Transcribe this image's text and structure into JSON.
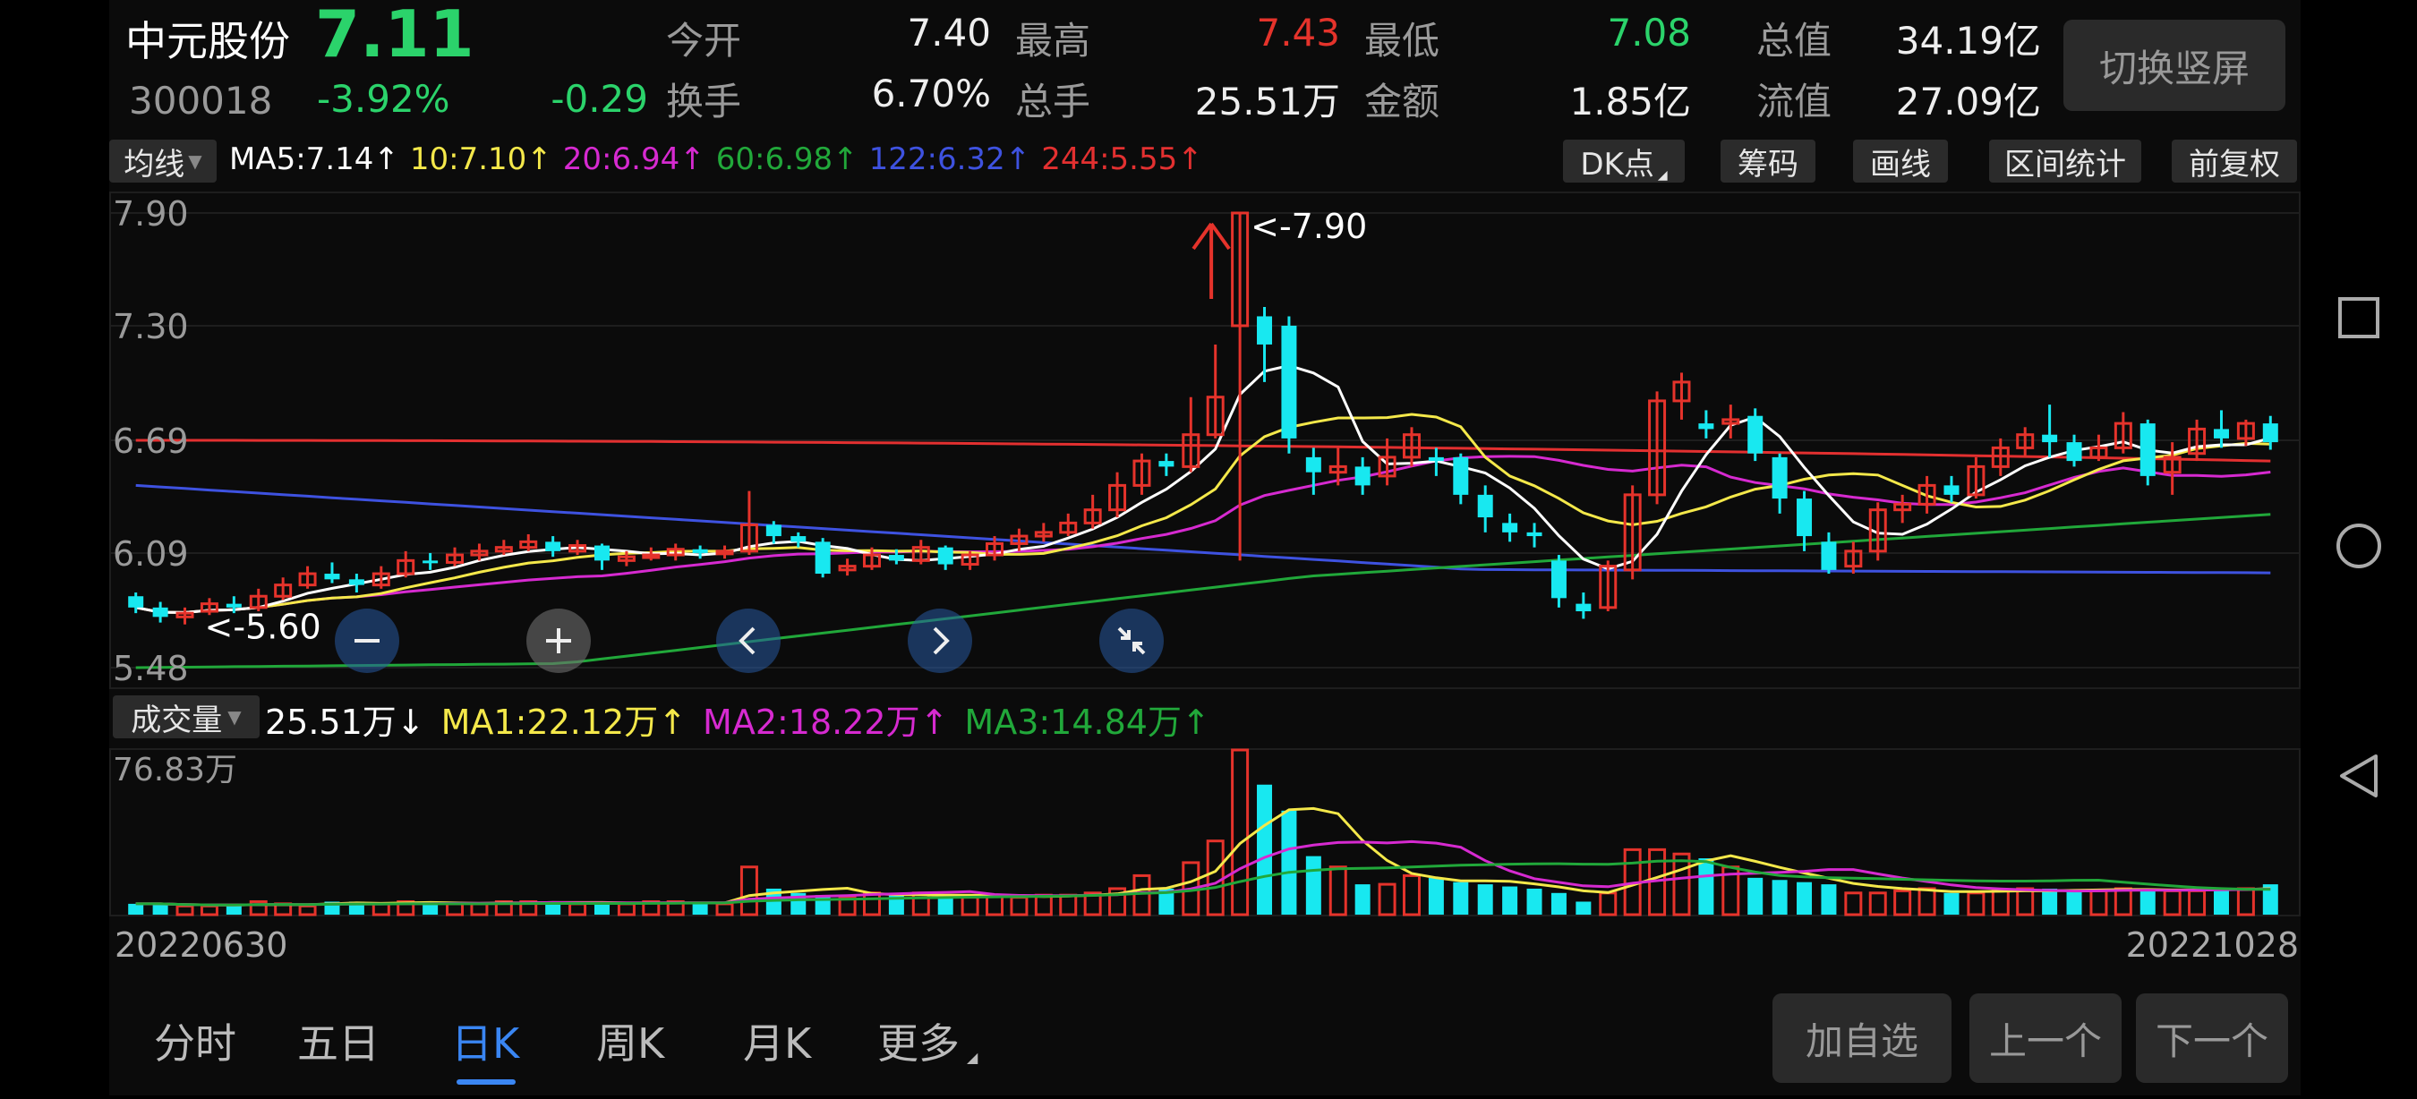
{
  "stock": {
    "name": "中元股份",
    "code": "300018",
    "price": "7.11",
    "change_pct": "-3.92%",
    "change": "-0.29"
  },
  "stats": [
    {
      "label": "今开",
      "value": "7.40",
      "color": "white"
    },
    {
      "label": "最高",
      "value": "7.43",
      "color": "red"
    },
    {
      "label": "最低",
      "value": "7.08",
      "color": "green"
    },
    {
      "label": "总值",
      "value": "34.19亿",
      "color": "white"
    },
    {
      "label": "换手",
      "value": "6.70%",
      "color": "white"
    },
    {
      "label": "总手",
      "value": "25.51万",
      "color": "white"
    },
    {
      "label": "金额",
      "value": "1.85亿",
      "color": "white"
    },
    {
      "label": "流值",
      "value": "27.09亿",
      "color": "white"
    }
  ],
  "switch_button": "切换竖屏",
  "ma_bar": {
    "selector": "均线",
    "items": [
      {
        "text": "MA5:7.14↑",
        "color": "#ffffff"
      },
      {
        "text": "10:7.10↑",
        "color": "#f4e84a"
      },
      {
        "text": "20:6.94↑",
        "color": "#d62ad0"
      },
      {
        "text": "60:6.98↑",
        "color": "#21a83a"
      },
      {
        "text": "122:6.32↑",
        "color": "#3e52e0"
      },
      {
        "text": "244:5.55↑",
        "color": "#e33030"
      }
    ],
    "tools": [
      "DK点",
      "筹码",
      "画线",
      "区间统计",
      "前复权"
    ]
  },
  "price_axis": [
    "7.90",
    "7.30",
    "6.69",
    "6.09",
    "5.48"
  ],
  "annotations": {
    "high": "<-7.90",
    "low": "<-5.60"
  },
  "controls": [
    "zoom-out",
    "zoom-in",
    "scroll-left",
    "scroll-right",
    "collapse"
  ],
  "volume_bar": {
    "selector": "成交量",
    "items": [
      {
        "text": "25.51万↓",
        "color": "#ffffff"
      },
      {
        "text": "MA1:22.12万↑",
        "color": "#f4e84a"
      },
      {
        "text": "MA2:18.22万↑",
        "color": "#d62ad0"
      },
      {
        "text": "MA3:14.84万↑",
        "color": "#21a83a"
      }
    ],
    "axis_max": "76.83万"
  },
  "dates": {
    "start": "20220630",
    "end": "20221028"
  },
  "tabs": [
    {
      "label": "分时",
      "active": false
    },
    {
      "label": "五日",
      "active": false
    },
    {
      "label": "日K",
      "active": true
    },
    {
      "label": "周K",
      "active": false
    },
    {
      "label": "月K",
      "active": false
    },
    {
      "label": "更多",
      "active": false
    }
  ],
  "bottom_buttons": [
    "加自选",
    "上一个",
    "下一个"
  ],
  "colors": {
    "up": "#e5332b",
    "down": "#18e8f0",
    "ma5": "#ffffff",
    "ma10": "#f4e84a",
    "ma20": "#d62ad0",
    "ma60": "#21a83a",
    "ma122": "#3e52e0",
    "ma244": "#e33030"
  },
  "chart_data": {
    "type": "candlestick",
    "y_range": [
      5.48,
      7.9
    ],
    "candles": [
      [
        5.86,
        5.8,
        5.88,
        5.77
      ],
      [
        5.8,
        5.75,
        5.83,
        5.72
      ],
      [
        5.75,
        5.77,
        5.8,
        5.71
      ],
      [
        5.78,
        5.82,
        5.85,
        5.76
      ],
      [
        5.82,
        5.8,
        5.86,
        5.77
      ],
      [
        5.8,
        5.86,
        5.9,
        5.78
      ],
      [
        5.86,
        5.92,
        5.96,
        5.84
      ],
      [
        5.92,
        5.98,
        6.02,
        5.9
      ],
      [
        5.98,
        5.95,
        6.04,
        5.93
      ],
      [
        5.95,
        5.92,
        5.98,
        5.88
      ],
      [
        5.92,
        5.98,
        6.02,
        5.9
      ],
      [
        5.98,
        6.05,
        6.1,
        5.96
      ],
      [
        6.05,
        6.04,
        6.09,
        6.0
      ],
      [
        6.04,
        6.08,
        6.12,
        6.02
      ],
      [
        6.08,
        6.1,
        6.14,
        6.05
      ],
      [
        6.1,
        6.12,
        6.16,
        6.08
      ],
      [
        6.12,
        6.15,
        6.19,
        6.1
      ],
      [
        6.15,
        6.1,
        6.18,
        6.07
      ],
      [
        6.1,
        6.13,
        6.16,
        6.08
      ],
      [
        6.13,
        6.05,
        6.14,
        6.0
      ],
      [
        6.05,
        6.07,
        6.1,
        6.02
      ],
      [
        6.07,
        6.08,
        6.12,
        6.05
      ],
      [
        6.08,
        6.11,
        6.14,
        6.05
      ],
      [
        6.11,
        6.09,
        6.13,
        6.06
      ],
      [
        6.09,
        6.1,
        6.13,
        6.06
      ],
      [
        6.1,
        6.24,
        6.42,
        6.08
      ],
      [
        6.24,
        6.18,
        6.26,
        6.14
      ],
      [
        6.18,
        6.15,
        6.2,
        6.12
      ],
      [
        6.15,
        5.98,
        6.17,
        5.96
      ],
      [
        6.0,
        6.02,
        6.06,
        5.97
      ],
      [
        6.02,
        6.08,
        6.12,
        6.0
      ],
      [
        6.08,
        6.05,
        6.11,
        6.03
      ],
      [
        6.05,
        6.12,
        6.16,
        6.03
      ],
      [
        6.12,
        6.03,
        6.13,
        6.0
      ],
      [
        6.03,
        6.08,
        6.1,
        6.0
      ],
      [
        6.08,
        6.14,
        6.18,
        6.05
      ],
      [
        6.14,
        6.18,
        6.22,
        6.1
      ],
      [
        6.18,
        6.2,
        6.25,
        6.15
      ],
      [
        6.2,
        6.25,
        6.3,
        6.18
      ],
      [
        6.25,
        6.32,
        6.4,
        6.22
      ],
      [
        6.32,
        6.45,
        6.52,
        6.28
      ],
      [
        6.45,
        6.58,
        6.62,
        6.4
      ],
      [
        6.58,
        6.55,
        6.62,
        6.5
      ],
      [
        6.55,
        6.72,
        6.92,
        6.52
      ],
      [
        6.72,
        6.92,
        7.2,
        6.7
      ],
      [
        7.3,
        7.9,
        7.9,
        6.05
      ],
      [
        7.35,
        7.2,
        7.4,
        7.0
      ],
      [
        7.3,
        6.7,
        7.35,
        6.62
      ],
      [
        6.6,
        6.52,
        6.65,
        6.4
      ],
      [
        6.52,
        6.55,
        6.65,
        6.45
      ],
      [
        6.55,
        6.45,
        6.6,
        6.4
      ],
      [
        6.5,
        6.6,
        6.7,
        6.45
      ],
      [
        6.6,
        6.72,
        6.76,
        6.55
      ],
      [
        6.6,
        6.58,
        6.65,
        6.5
      ],
      [
        6.6,
        6.4,
        6.62,
        6.35
      ],
      [
        6.4,
        6.28,
        6.45,
        6.2
      ],
      [
        6.25,
        6.2,
        6.3,
        6.15
      ],
      [
        6.2,
        6.18,
        6.25,
        6.12
      ],
      [
        6.05,
        5.85,
        6.08,
        5.8
      ],
      [
        5.82,
        5.78,
        5.88,
        5.74
      ],
      [
        5.8,
        6.02,
        6.05,
        5.78
      ],
      [
        6.0,
        6.4,
        6.45,
        5.95
      ],
      [
        6.4,
        6.9,
        6.95,
        6.35
      ],
      [
        6.9,
        7.0,
        7.05,
        6.8
      ],
      [
        6.78,
        6.75,
        6.85,
        6.7
      ],
      [
        6.78,
        6.8,
        6.88,
        6.7
      ],
      [
        6.82,
        6.62,
        6.86,
        6.58
      ],
      [
        6.6,
        6.38,
        6.62,
        6.3
      ],
      [
        6.38,
        6.18,
        6.42,
        6.1
      ],
      [
        6.15,
        6.0,
        6.2,
        5.98
      ],
      [
        6.02,
        6.1,
        6.15,
        5.98
      ],
      [
        6.1,
        6.32,
        6.36,
        6.05
      ],
      [
        6.32,
        6.35,
        6.4,
        6.25
      ],
      [
        6.35,
        6.45,
        6.5,
        6.3
      ],
      [
        6.45,
        6.4,
        6.5,
        6.36
      ],
      [
        6.4,
        6.55,
        6.6,
        6.38
      ],
      [
        6.55,
        6.65,
        6.7,
        6.5
      ],
      [
        6.65,
        6.72,
        6.76,
        6.6
      ],
      [
        6.72,
        6.68,
        6.88,
        6.6
      ],
      [
        6.68,
        6.58,
        6.72,
        6.55
      ],
      [
        6.6,
        6.65,
        6.72,
        6.58
      ],
      [
        6.65,
        6.78,
        6.84,
        6.62
      ],
      [
        6.78,
        6.5,
        6.8,
        6.45
      ],
      [
        6.52,
        6.6,
        6.68,
        6.4
      ],
      [
        6.62,
        6.75,
        6.8,
        6.58
      ],
      [
        6.75,
        6.7,
        6.85,
        6.65
      ],
      [
        6.7,
        6.78,
        6.8,
        6.66
      ],
      [
        6.78,
        6.68,
        6.82,
        6.64
      ]
    ],
    "volume_max": 76.83,
    "volumes": [
      5,
      5,
      4,
      4,
      4,
      6,
      5,
      4,
      6,
      6,
      5,
      6,
      5,
      5,
      5,
      6,
      6,
      6,
      5,
      5,
      5,
      6,
      6,
      5,
      5,
      22,
      12,
      10,
      9,
      8,
      10,
      9,
      10,
      8,
      8,
      9,
      8,
      9,
      9,
      10,
      12,
      18,
      12,
      24,
      34,
      76,
      60,
      48,
      27,
      22,
      14,
      14,
      18,
      17,
      15,
      14,
      13,
      12,
      10,
      6,
      10,
      30,
      30,
      28,
      26,
      22,
      17,
      16,
      15,
      14,
      10,
      10,
      11,
      12,
      10,
      10,
      11,
      12,
      12,
      11,
      11,
      12,
      12,
      11,
      11,
      12,
      12,
      14
    ],
    "volume_ma_lines": [
      "ma1",
      "ma2",
      "ma3"
    ]
  }
}
